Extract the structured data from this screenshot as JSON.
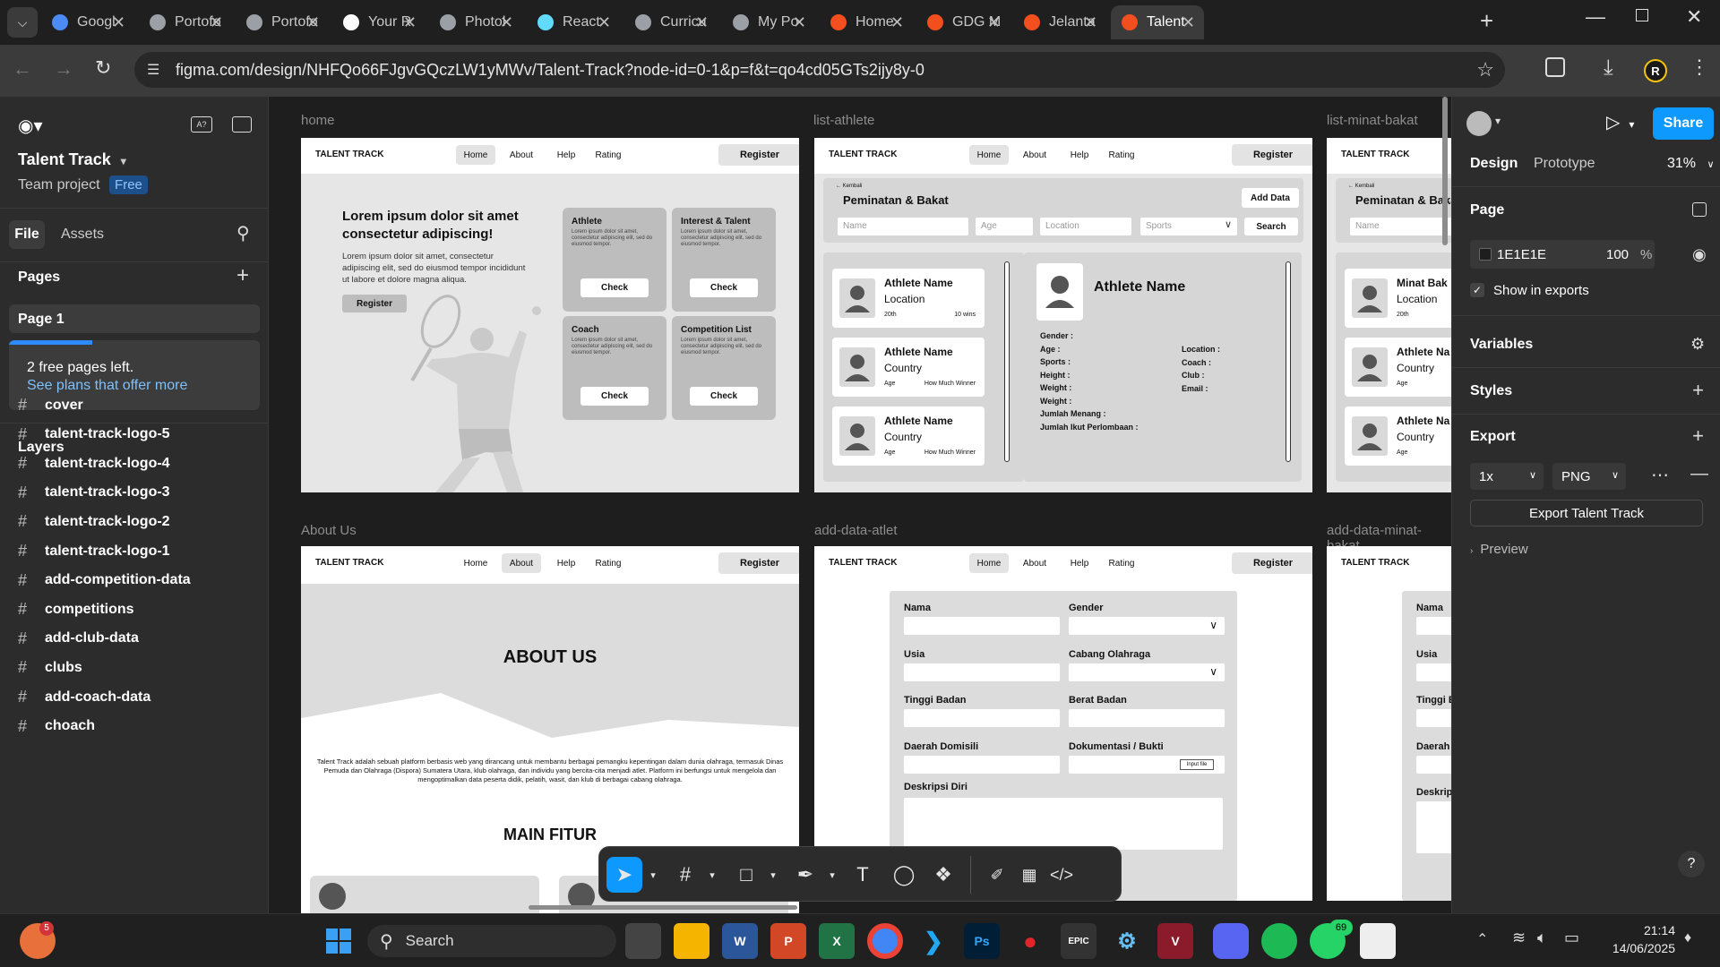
{
  "browser": {
    "tabs": [
      {
        "label": "Googl",
        "icon": "gemini-icon",
        "color": "#4c8bf5"
      },
      {
        "label": "Portofo",
        "icon": "globe-icon",
        "color": "#9aa0a6"
      },
      {
        "label": "Portofo",
        "icon": "globe-icon",
        "color": "#9aa0a6"
      },
      {
        "label": "Your R",
        "icon": "github-icon",
        "color": "#ffffff"
      },
      {
        "label": "Photol",
        "icon": "globe-icon",
        "color": "#9aa0a6"
      },
      {
        "label": "React",
        "icon": "react-icon",
        "color": "#61dafb"
      },
      {
        "label": "Curricu",
        "icon": "globe-icon",
        "color": "#9aa0a6"
      },
      {
        "label": "My Po",
        "icon": "globe-icon",
        "color": "#9aa0a6"
      },
      {
        "label": "Home",
        "icon": "figma-icon",
        "color": "#f24e1e"
      },
      {
        "label": "GDG M",
        "icon": "figma-icon",
        "color": "#f24e1e"
      },
      {
        "label": "Jelanta",
        "icon": "figma-icon",
        "color": "#f24e1e"
      },
      {
        "label": "Talent",
        "icon": "figma-icon",
        "color": "#f24e1e"
      }
    ],
    "url": "figma.com/design/NHFQo66FJgvGQczLW1yMWv/Talent-Track?node-id=0-1&p=f&t=qo4cd05GTs2ijy8y-0",
    "profile_initial": "R"
  },
  "figma": {
    "file_title": "Talent Track",
    "team": "Team project",
    "plan_badge": "Free",
    "left_tabs": [
      "File",
      "Assets"
    ],
    "pages_heading": "Pages",
    "current_page": "Page 1",
    "upgrade": {
      "line1": "2 free pages left.",
      "line2": "See plans that offer more"
    },
    "layers_heading": "Layers",
    "layers": [
      "cover",
      "talent-track-logo-5",
      "talent-track-logo-4",
      "talent-track-logo-3",
      "talent-track-logo-2",
      "talent-track-logo-1",
      "add-competition-data",
      "competitions",
      "add-club-data",
      "clubs",
      "add-coach-data",
      "choach"
    ],
    "right": {
      "tabs": [
        "Design",
        "Prototype"
      ],
      "zoom": "31%",
      "share": "Share",
      "page_heading": "Page",
      "bg_color": "1E1E1E",
      "bg_opacity": "100",
      "pct": "%",
      "show_exports": "Show in exports",
      "variables": "Variables",
      "styles": "Styles",
      "export": "Export",
      "export_scale": "1x",
      "export_format": "PNG",
      "export_button": "Export Talent Track",
      "preview": "Preview"
    }
  },
  "frames": {
    "labels": [
      "home",
      "list-athlete",
      "list-minat-bakat",
      "About Us",
      "add-data-atlet",
      "add-data-minat-bakat"
    ],
    "nav": {
      "brand": "TALENT TRACK",
      "items": [
        "Home",
        "About",
        "Help",
        "Rating"
      ],
      "register": "Register"
    },
    "home": {
      "hero_title": "Lorem ipsum dolor sit amet consectetur adipiscing!",
      "hero_text": "Lorem ipsum dolor sit amet, consectetur adipiscing elit, sed do eiusmod tempor incididunt ut labore et dolore magna aliqua.",
      "hero_button": "Register",
      "cards": [
        {
          "title": "Athlete",
          "text": "Lorem ipsum dolor sit amet, consectetur adipiscing elit, sed do eiusmod tempor.",
          "button": "Check"
        },
        {
          "title": "Interest & Talent",
          "text": "Lorem ipsum dolor sit amet, consectetur adipiscing elit, sed do eiusmod tempor.",
          "button": "Check"
        },
        {
          "title": "Coach",
          "text": "Lorem ipsum dolor sit amet, consectetur adipiscing elit, sed do eiusmod tempor.",
          "button": "Check"
        },
        {
          "title": "Competition List",
          "text": "Lorem ipsum dolor sit amet, consectetur adipiscing elit, sed do eiusmod tempor.",
          "button": "Check"
        }
      ]
    },
    "list": {
      "back": "Kembali",
      "title": "Peminatan & Bakat",
      "add": "Add Data",
      "filters": [
        "Name",
        "Age",
        "Location",
        "Sports"
      ],
      "search": "Search",
      "items": [
        {
          "name": "Athlete Name",
          "loc": "Location",
          "s1": "20th",
          "s2": "10 wins"
        },
        {
          "name": "Athlete Name",
          "loc": "Country",
          "s1": "Age",
          "s2": "How Much Winner"
        },
        {
          "name": "Athlete Name",
          "loc": "Country",
          "s1": "Age",
          "s2": "How Much Winner"
        }
      ],
      "detail_name": "Athlete Name",
      "detail_left": [
        "Gender :",
        "Age :",
        "Sports :",
        "Height :",
        "Weight :",
        "Weight :",
        "Jumlah Menang :",
        "Jumlah Ikut Perlombaan :"
      ],
      "detail_right": [
        "Location :",
        "Coach :",
        "Club :",
        "Email :"
      ]
    },
    "minat": {
      "title": "Peminatan & Bakat",
      "filter": "Name",
      "items": [
        {
          "name": "Minat Bak",
          "loc": "Location",
          "s1": "20th"
        },
        {
          "name": "Athlete Na",
          "loc": "Country",
          "s1": "Age"
        },
        {
          "name": "Athlete Na",
          "loc": "Country",
          "s1": "Age"
        }
      ]
    },
    "about": {
      "heading": "ABOUT US",
      "text": "Talent Track adalah sebuah platform berbasis web yang dirancang untuk membantu berbagai pemangku kepentingan dalam dunia olahraga, termasuk Dinas Pemuda dan Olahraga (Dispora) Sumatera Utara, klub olahraga, dan individu yang bercita-cita menjadi atlet. Platform ini berfungsi untuk mengelola dan mengoptimalkan data peserta didik, pelatih, wasit, dan klub di berbagai cabang olahraga.",
      "features": "MAIN FITUR"
    },
    "form": {
      "left": [
        "Nama",
        "Usia",
        "Tinggi Badan",
        "Daerah Domisili"
      ],
      "right": [
        "Gender",
        "Cabang Olahraga",
        "Berat Badan",
        "Dokumentasi / Bukti"
      ],
      "input_file": "Input file",
      "desc": "Deskripsi Diri"
    },
    "form2": {
      "labels": [
        "Nama",
        "Usia",
        "Tinggi B",
        "Daerah D",
        "Deskrip"
      ]
    }
  },
  "taskbar": {
    "search": "Search",
    "time": "21:14",
    "date": "14/06/2025",
    "notif_copilot": "5",
    "notif_whatsapp": "69"
  }
}
